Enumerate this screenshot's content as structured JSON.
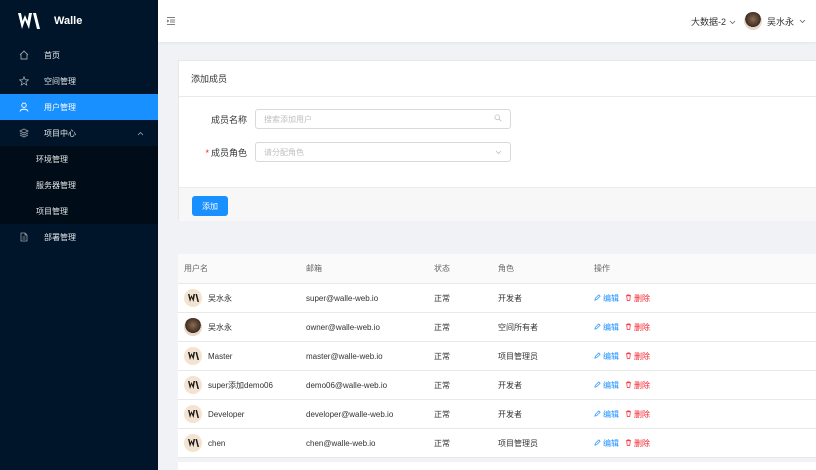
{
  "app": {
    "logo_text": "Walle"
  },
  "sidebar": {
    "items": [
      {
        "label": "首页",
        "icon": "home-icon"
      },
      {
        "label": "空间管理",
        "icon": "star-icon"
      },
      {
        "label": "用户管理",
        "icon": "user-icon",
        "active": true
      },
      {
        "label": "项目中心",
        "icon": "layers-icon",
        "expanded": true
      },
      {
        "label": "环境管理"
      },
      {
        "label": "服务器管理"
      },
      {
        "label": "项目管理"
      },
      {
        "label": "部署管理",
        "icon": "deploy-icon"
      }
    ]
  },
  "header": {
    "space": "大数据-2",
    "user": "吴水永"
  },
  "form": {
    "title": "添加成员",
    "name_label": "成员名称",
    "name_placeholder": "搜索添加用户",
    "role_label": "成员角色",
    "role_placeholder": "请分配角色",
    "required_mark": "*",
    "add_button": "添加"
  },
  "table": {
    "columns": [
      "用户名",
      "邮箱",
      "状态",
      "角色",
      "操作"
    ],
    "edit_label": "编辑",
    "delete_label": "删除",
    "rows": [
      {
        "username": "吴水永",
        "email": "super@walle-web.io",
        "status": "正常",
        "role": "开发者"
      },
      {
        "username": "吴水永",
        "email": "owner@walle-web.io",
        "status": "正常",
        "role": "空间所有者"
      },
      {
        "username": "Master",
        "email": "master@walle-web.io",
        "status": "正常",
        "role": "项目管理员"
      },
      {
        "username": "super添加demo06",
        "email": "demo06@walle-web.io",
        "status": "正常",
        "role": "开发者"
      },
      {
        "username": "Developer",
        "email": "developer@walle-web.io",
        "status": "正常",
        "role": "开发者"
      },
      {
        "username": "chen",
        "email": "chen@walle-web.io",
        "status": "正常",
        "role": "项目管理员"
      }
    ]
  },
  "colors": {
    "primary": "#1890ff",
    "sidebar_bg": "#001529",
    "danger": "#f5222d"
  }
}
